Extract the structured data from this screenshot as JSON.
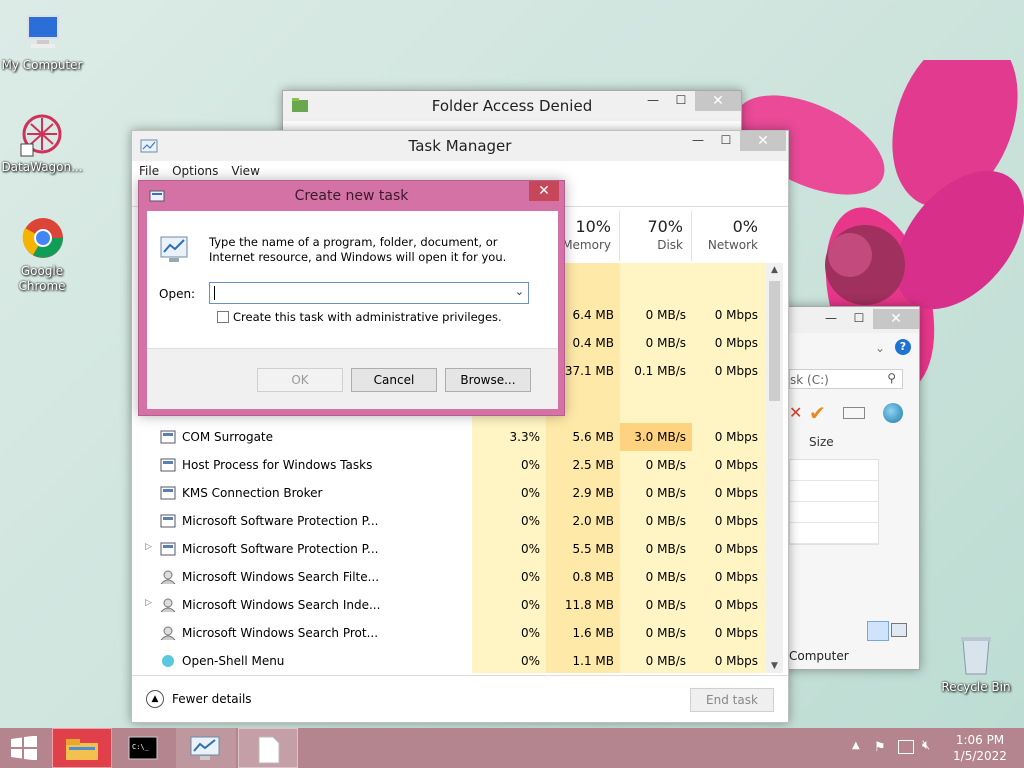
{
  "desktop": {
    "icons": [
      {
        "label": "My Computer"
      },
      {
        "label": "DataWagon..."
      },
      {
        "label": "Google Chrome"
      },
      {
        "label": "Recycle Bin"
      }
    ]
  },
  "folder_access": {
    "title": "Folder Access Denied"
  },
  "explorer": {
    "search_placeholder": "sk (C:)",
    "col_size": "Size",
    "status": "Computer"
  },
  "task_manager": {
    "title": "Task Manager",
    "menu": [
      "File",
      "Options",
      "View"
    ],
    "headers": [
      {
        "pct": "10%",
        "label": "Memory"
      },
      {
        "pct": "70%",
        "label": "Disk"
      },
      {
        "pct": "0%",
        "label": "Network"
      }
    ],
    "partial_rows": [
      {
        "mem": "6.4 MB",
        "disk": "0 MB/s",
        "net": "0 Mbps"
      },
      {
        "mem": "0.4 MB",
        "disk": "0 MB/s",
        "net": "0 Mbps"
      },
      {
        "mem": "37.1 MB",
        "disk": "0.1 MB/s",
        "net": "0 Mbps"
      }
    ],
    "rows": [
      {
        "name": "COM Surrogate",
        "cpu": "3.3%",
        "mem": "5.6 MB",
        "disk": "3.0 MB/s",
        "net": "0 Mbps",
        "expand": ""
      },
      {
        "name": "Host Process for Windows Tasks",
        "cpu": "0%",
        "mem": "2.5 MB",
        "disk": "0 MB/s",
        "net": "0 Mbps",
        "expand": ""
      },
      {
        "name": "KMS Connection Broker",
        "cpu": "0%",
        "mem": "2.9 MB",
        "disk": "0 MB/s",
        "net": "0 Mbps",
        "expand": ""
      },
      {
        "name": "Microsoft Software Protection P...",
        "cpu": "0%",
        "mem": "2.0 MB",
        "disk": "0 MB/s",
        "net": "0 Mbps",
        "expand": ""
      },
      {
        "name": "Microsoft Software Protection P...",
        "cpu": "0%",
        "mem": "5.5 MB",
        "disk": "0 MB/s",
        "net": "0 Mbps",
        "expand": "▷"
      },
      {
        "name": "Microsoft Windows Search Filte...",
        "cpu": "0%",
        "mem": "0.8 MB",
        "disk": "0 MB/s",
        "net": "0 Mbps",
        "expand": ""
      },
      {
        "name": "Microsoft Windows Search Inde...",
        "cpu": "0%",
        "mem": "11.8 MB",
        "disk": "0 MB/s",
        "net": "0 Mbps",
        "expand": "▷"
      },
      {
        "name": "Microsoft Windows Search Prot...",
        "cpu": "0%",
        "mem": "1.6 MB",
        "disk": "0 MB/s",
        "net": "0 Mbps",
        "expand": ""
      },
      {
        "name": "Open-Shell Menu",
        "cpu": "0%",
        "mem": "1.1 MB",
        "disk": "0 MB/s",
        "net": "0 Mbps",
        "expand": ""
      }
    ],
    "fewer_details": "Fewer details",
    "end_task": "End task"
  },
  "create_task": {
    "title": "Create new task",
    "description": "Type the name of a program, folder, document, or Internet resource, and Windows will open it for you.",
    "open_label": "Open:",
    "open_value": "",
    "admin_label": "Create this task with administrative privileges.",
    "ok": "OK",
    "cancel": "Cancel",
    "browse": "Browse..."
  },
  "taskbar": {
    "time": "1:06 PM",
    "date": "1/5/2022"
  },
  "colors": {
    "dialog_border": "#d472a6",
    "taskbar": "#b4858f",
    "close_red": "#c7475a"
  }
}
